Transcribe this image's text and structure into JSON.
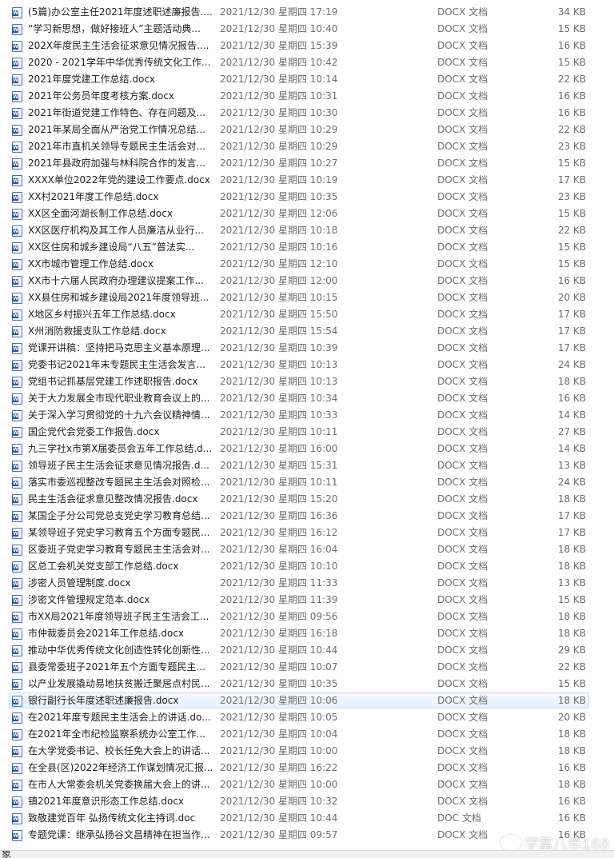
{
  "files": [
    {
      "name": "(5篇)办公室主任2021年度述职述廉报告....",
      "date": "2021/12/30 星期四 17:19",
      "type": "DOCX 文档",
      "size": "34 KB"
    },
    {
      "name": "“学习新思想，做好接班人”主题活动典...",
      "date": "2021/12/30 星期四 10:40",
      "type": "DOCX 文档",
      "size": "15 KB"
    },
    {
      "name": "202X年度民主生活会征求意见情况报告....",
      "date": "2021/12/30 星期四 15:39",
      "type": "DOCX 文档",
      "size": "16 KB"
    },
    {
      "name": "2020 - 2021学年中华优秀传统文化工作...",
      "date": "2021/12/30 星期四 10:42",
      "type": "DOCX 文档",
      "size": "15 KB"
    },
    {
      "name": "2021年度党建工作总结.docx",
      "date": "2021/12/30 星期四 10:14",
      "type": "DOCX 文档",
      "size": "22 KB"
    },
    {
      "name": "2021年公务员年度考核方案.docx",
      "date": "2021/12/30 星期四 10:31",
      "type": "DOCX 文档",
      "size": "16 KB"
    },
    {
      "name": "2021年街道党建工作特色、存在问题及...",
      "date": "2021/12/30 星期四 10:30",
      "type": "DOCX 文档",
      "size": "16 KB"
    },
    {
      "name": "2021年某局全面从严治党工作情况总结...",
      "date": "2021/12/30 星期四 10:29",
      "type": "DOCX 文档",
      "size": "22 KB"
    },
    {
      "name": "2021年市直机关领导专题民主生活会对...",
      "date": "2021/12/30 星期四 10:29",
      "type": "DOCX 文档",
      "size": "23 KB"
    },
    {
      "name": "2021年县政府加强与林科院合作的发言...",
      "date": "2021/12/30 星期四 10:27",
      "type": "DOCX 文档",
      "size": "15 KB"
    },
    {
      "name": "XXXX单位2022年党的建设工作要点.docx",
      "date": "2021/12/30 星期四 10:19",
      "type": "DOCX 文档",
      "size": "17 KB"
    },
    {
      "name": "XX村2021年度工作总结.docx",
      "date": "2021/12/30 星期四 10:35",
      "type": "DOCX 文档",
      "size": "23 KB"
    },
    {
      "name": "XX区全面河湖长制工作总结.docx",
      "date": "2021/12/30 星期四 12:06",
      "type": "DOCX 文档",
      "size": "15 KB"
    },
    {
      "name": "XX区医疗机构及其工作人员廉洁从业行...",
      "date": "2021/12/30 星期四 10:18",
      "type": "DOCX 文档",
      "size": "22 KB"
    },
    {
      "name": "XX区住房和城乡建设局“八五”普法实...",
      "date": "2021/12/30 星期四 10:16",
      "type": "DOCX 文档",
      "size": "15 KB"
    },
    {
      "name": "XX市城市管理工作总结.docx",
      "date": "2021/12/30 星期四 12:10",
      "type": "DOCX 文档",
      "size": "15 KB"
    },
    {
      "name": "XX市十六届人民政府办理建议提案工作...",
      "date": "2021/12/30 星期四 12:00",
      "type": "DOCX 文档",
      "size": "16 KB"
    },
    {
      "name": "XX县住房和城乡建设局2021年度领导班...",
      "date": "2021/12/30 星期四 10:15",
      "type": "DOCX 文档",
      "size": "20 KB"
    },
    {
      "name": "X地区乡村振兴五年工作总结.docx",
      "date": "2021/12/30 星期四 15:50",
      "type": "DOCX 文档",
      "size": "17 KB"
    },
    {
      "name": "X州消防救援支队工作总结.docx",
      "date": "2021/12/30 星期四 15:54",
      "type": "DOCX 文档",
      "size": "17 KB"
    },
    {
      "name": "党课开讲稿：坚持把马克思主义基本原理...",
      "date": "2021/12/30 星期四 10:39",
      "type": "DOCX 文档",
      "size": "17 KB"
    },
    {
      "name": "党委书记2021年末专题民主生活会发言...",
      "date": "2021/12/30 星期四 10:13",
      "type": "DOCX 文档",
      "size": "24 KB"
    },
    {
      "name": "党组书记抓基层党建工作述职报告.docx",
      "date": "2021/12/30 星期四 10:13",
      "type": "DOCX 文档",
      "size": "18 KB"
    },
    {
      "name": "关于大力发展全市现代职业教育会议上的...",
      "date": "2021/12/30 星期四 10:34",
      "type": "DOCX 文档",
      "size": "16 KB"
    },
    {
      "name": "关于深入学习贯彻党的十九六会议精神情...",
      "date": "2021/12/30 星期四 10:33",
      "type": "DOCX 文档",
      "size": "14 KB"
    },
    {
      "name": "国企党代会党委工作报告.docx",
      "date": "2021/12/30 星期四 10:11",
      "type": "DOCX 文档",
      "size": "27 KB"
    },
    {
      "name": "九三学社x市第X届委员会五年工作总结.d...",
      "date": "2021/12/30 星期四 16:00",
      "type": "DOCX 文档",
      "size": "14 KB"
    },
    {
      "name": "领导班子民主生活会征求意见情况报告.d...",
      "date": "2021/12/30 星期四 15:31",
      "type": "DOCX 文档",
      "size": "13 KB"
    },
    {
      "name": "落实市委巡视整改专题民主生活会对照检...",
      "date": "2021/12/30 星期四 10:11",
      "type": "DOCX 文档",
      "size": "24 KB"
    },
    {
      "name": "民主生活会征求意见整改情况报告.docx",
      "date": "2021/12/30 星期四 15:20",
      "type": "DOCX 文档",
      "size": "18 KB"
    },
    {
      "name": "某国企子分公司党总支党史学习教育总结...",
      "date": "2021/12/30 星期四 16:36",
      "type": "DOCX 文档",
      "size": "17 KB"
    },
    {
      "name": "某领导班子党史学习教育五个方面专题民...",
      "date": "2021/12/30 星期四 16:12",
      "type": "DOCX 文档",
      "size": "17 KB"
    },
    {
      "name": "区委班子党史学习教育专题民主生活会对...",
      "date": "2021/12/30 星期四 16:04",
      "type": "DOCX 文档",
      "size": "18 KB"
    },
    {
      "name": "区总工会机关党支部工作总结.docx",
      "date": "2021/12/30 星期四 10:10",
      "type": "DOCX 文档",
      "size": "18 KB"
    },
    {
      "name": "涉密人员管理制度.docx",
      "date": "2021/12/30 星期四 11:33",
      "type": "DOCX 文档",
      "size": "13 KB"
    },
    {
      "name": "涉密文件管理规定范本.docx",
      "date": "2021/12/30 星期四 11:39",
      "type": "DOCX 文档",
      "size": "15 KB"
    },
    {
      "name": "市XX局2021年度领导班子民主生活会工...",
      "date": "2021/12/30 星期四 09:56",
      "type": "DOCX 文档",
      "size": "18 KB"
    },
    {
      "name": "市仲裁委员会2021年工作总结.docx",
      "date": "2021/12/30 星期四 16:18",
      "type": "DOCX 文档",
      "size": "18 KB"
    },
    {
      "name": "推动中华优秀传统文化创造性转化创新性...",
      "date": "2021/12/30 星期四 10:44",
      "type": "DOCX 文档",
      "size": "29 KB"
    },
    {
      "name": "县委常委班子2021年五个方面专题民主...",
      "date": "2021/12/30 星期四 10:07",
      "type": "DOCX 文档",
      "size": "22 KB"
    },
    {
      "name": "以产业发展撬动易地扶贫搬迁聚居点村民...",
      "date": "2021/12/30 星期四 10:35",
      "type": "DOCX 文档",
      "size": "15 KB"
    },
    {
      "name": "银行副行长年度述职述廉报告.docx",
      "date": "2021/12/30 星期四 10:06",
      "type": "DOCX 文档",
      "size": "18 KB",
      "selected": true
    },
    {
      "name": "在2021年度专题民主生活会上的讲话.do...",
      "date": "2021/12/30 星期四 10:05",
      "type": "DOCX 文档",
      "size": "20 KB"
    },
    {
      "name": "在2021年全市纪检监察系统办公室工作...",
      "date": "2021/12/30 星期四 10:04",
      "type": "DOCX 文档",
      "size": "18 KB"
    },
    {
      "name": "在大学党委书记、校长任免大会上的讲话...",
      "date": "2021/12/30 星期四 10:00",
      "type": "DOCX 文档",
      "size": "18 KB"
    },
    {
      "name": "在全县(区)2022年经济工作谋划情况汇报...",
      "date": "2021/12/30 星期四 16:22",
      "type": "DOCX 文档",
      "size": "16 KB"
    },
    {
      "name": "在市人大常委会机关党委换届大会上的讲...",
      "date": "2021/12/30 星期四 10:00",
      "type": "DOCX 文档",
      "size": "18 KB"
    },
    {
      "name": "镇2021年度意识形态工作总结.docx",
      "date": "2021/12/30 星期四 10:32",
      "type": "DOCX 文档",
      "size": "16 KB"
    },
    {
      "name": "致敬建党百年 弘扬传统文化主持词.doc",
      "date": "2021/12/30 星期四 10:44",
      "type": "DOC 文档",
      "size": "16 KB"
    },
    {
      "name": "专题党课：继承弘扬谷文昌精神在担当作...",
      "date": "2021/12/30 星期四 09:57",
      "type": "DOCX 文档",
      "size": "16 KB"
    }
  ],
  "watermark": {
    "text": "学富八年168"
  },
  "status": {
    "text": "象"
  }
}
